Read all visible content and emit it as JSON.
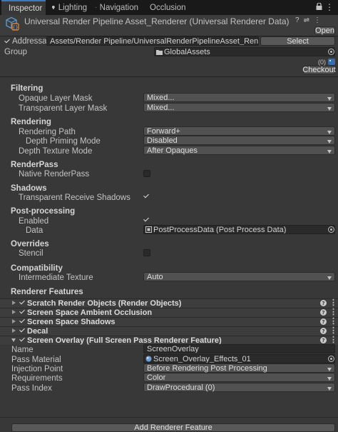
{
  "tabs": [
    {
      "label": "Inspector",
      "icon": "info-icon",
      "active": true
    },
    {
      "label": "Lighting",
      "icon": "lightbulb-icon",
      "active": false
    },
    {
      "label": "Navigation",
      "icon": "navigation-icon",
      "active": false
    },
    {
      "label": "Occlusion",
      "icon": "occlusion-icon",
      "active": false
    }
  ],
  "header": {
    "title": "Universal Render Pipeline Asset_Renderer (Universal Renderer Data)",
    "open_label": "Open"
  },
  "addressable": {
    "label": "Addressable",
    "checked": true,
    "path": "Assets/Render Pipeline/UniversalRenderPipelineAsset_Renderer.asset",
    "select_label": "Select"
  },
  "group": {
    "label": "Group",
    "value": "GlobalAssets",
    "count": "(0)",
    "checkout_label": "Checkout"
  },
  "filtering": {
    "title": "Filtering",
    "opaque_label": "Opaque Layer Mask",
    "opaque_value": "Mixed...",
    "transparent_label": "Transparent Layer Mask",
    "transparent_value": "Mixed..."
  },
  "rendering": {
    "title": "Rendering",
    "path_label": "Rendering Path",
    "path_value": "Forward+",
    "depth_priming_label": "Depth Priming Mode",
    "depth_priming_value": "Disabled",
    "depth_texture_label": "Depth Texture Mode",
    "depth_texture_value": "After Opaques"
  },
  "renderpass": {
    "title": "RenderPass",
    "native_label": "Native RenderPass",
    "native_checked": false
  },
  "shadows": {
    "title": "Shadows",
    "receive_label": "Transparent Receive Shadows",
    "receive_checked": true
  },
  "postprocessing": {
    "title": "Post-processing",
    "enabled_label": "Enabled",
    "enabled_checked": true,
    "data_label": "Data",
    "data_value": "PostProcessData (Post Process Data)"
  },
  "overrides": {
    "title": "Overrides",
    "stencil_label": "Stencil",
    "stencil_checked": false
  },
  "compatibility": {
    "title": "Compatibility",
    "intermediate_label": "Intermediate Texture",
    "intermediate_value": "Auto"
  },
  "features": {
    "title": "Renderer Features",
    "items": [
      {
        "label": "Scratch Render Objects (Render Objects)",
        "expanded": false
      },
      {
        "label": "Screen Space Ambient Occlusion",
        "expanded": false
      },
      {
        "label": "Screen Space Shadows",
        "expanded": false
      },
      {
        "label": "Decal",
        "expanded": false
      },
      {
        "label": "Screen Overlay (Full Screen Pass Renderer Feature)",
        "expanded": true
      }
    ],
    "overlay": {
      "name_label": "Name",
      "name_value": "ScreenOverlay",
      "material_label": "Pass Material",
      "material_value": "Screen_Overlay_Effects_01",
      "injection_label": "Injection Point",
      "injection_value": "Before Rendering Post Processing",
      "requirements_label": "Requirements",
      "requirements_value": "Color",
      "pass_index_label": "Pass Index",
      "pass_index_value": "DrawProcedural (0)"
    },
    "add_label": "Add Renderer Feature"
  },
  "colors": {
    "background": "#383838",
    "tab_bar": "#191919",
    "accent": "#3a79bb",
    "field": "#2a2a2a",
    "dropdown": "#515151"
  }
}
